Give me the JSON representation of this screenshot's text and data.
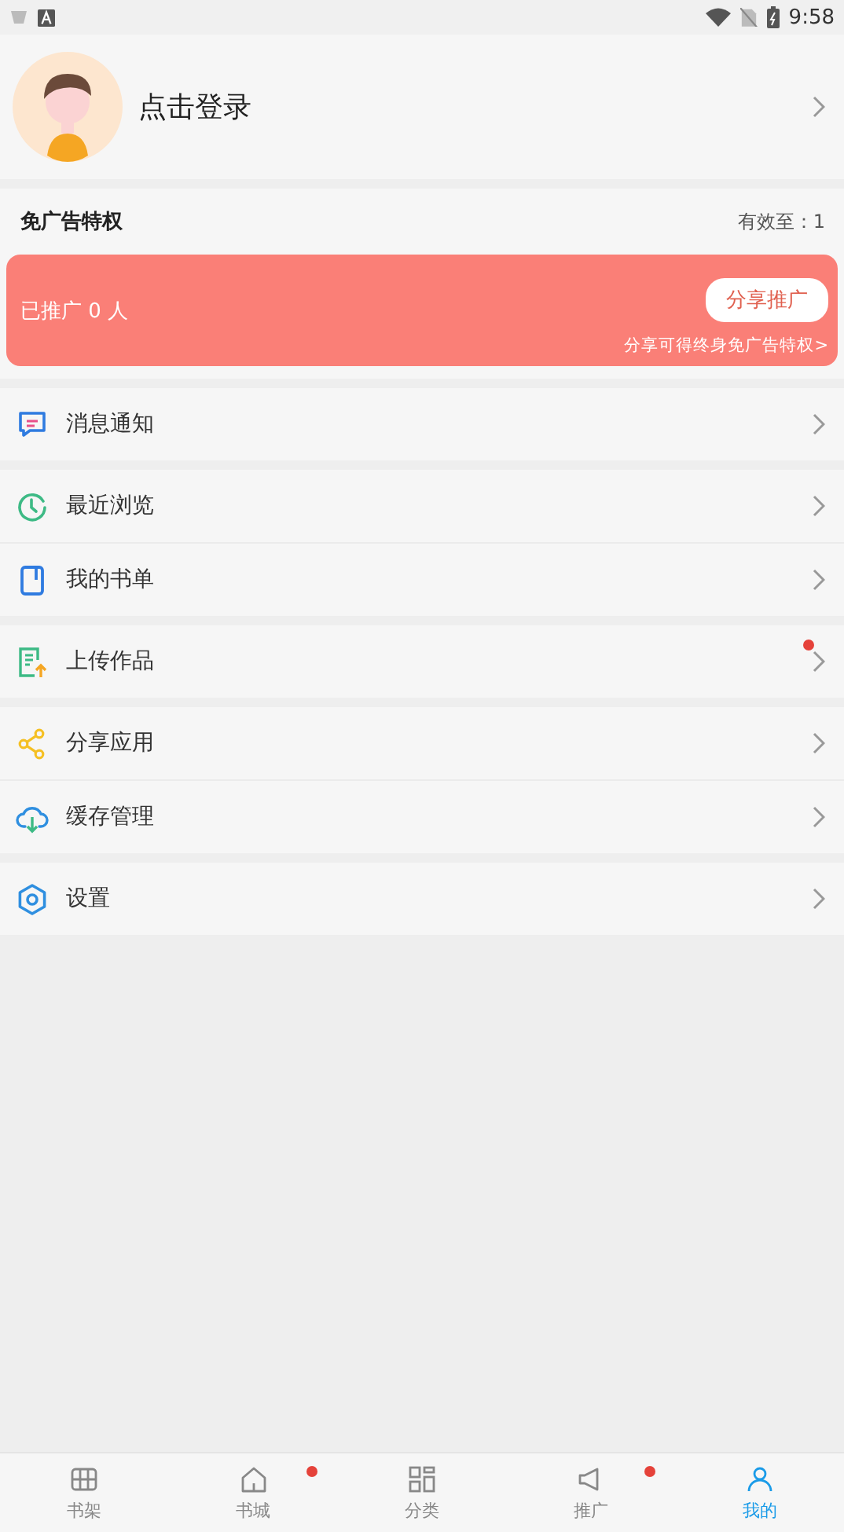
{
  "status_bar": {
    "time": "9:58"
  },
  "profile": {
    "login_text": "点击登录"
  },
  "ad_free": {
    "title": "免广告特权",
    "valid_until": "有效至：1",
    "promoted": "已推广 0 人",
    "share_button": "分享推广",
    "share_hint": "分享可得终身免广告特权>"
  },
  "menu_groups": [
    [
      {
        "label": "消息通知",
        "badge": false
      }
    ],
    [
      {
        "label": "最近浏览",
        "badge": false
      },
      {
        "label": "我的书单",
        "badge": false
      }
    ],
    [
      {
        "label": "上传作品",
        "badge": true
      }
    ],
    [
      {
        "label": "分享应用",
        "badge": false
      },
      {
        "label": "缓存管理",
        "badge": false
      }
    ],
    [
      {
        "label": "设置",
        "badge": false
      }
    ]
  ],
  "bottom_nav": [
    {
      "label": "书架",
      "selected": false,
      "badge": false
    },
    {
      "label": "书城",
      "selected": false,
      "badge": true
    },
    {
      "label": "分类",
      "selected": false,
      "badge": false
    },
    {
      "label": "推广",
      "selected": false,
      "badge": true
    },
    {
      "label": "我的",
      "selected": true,
      "badge": false
    }
  ]
}
